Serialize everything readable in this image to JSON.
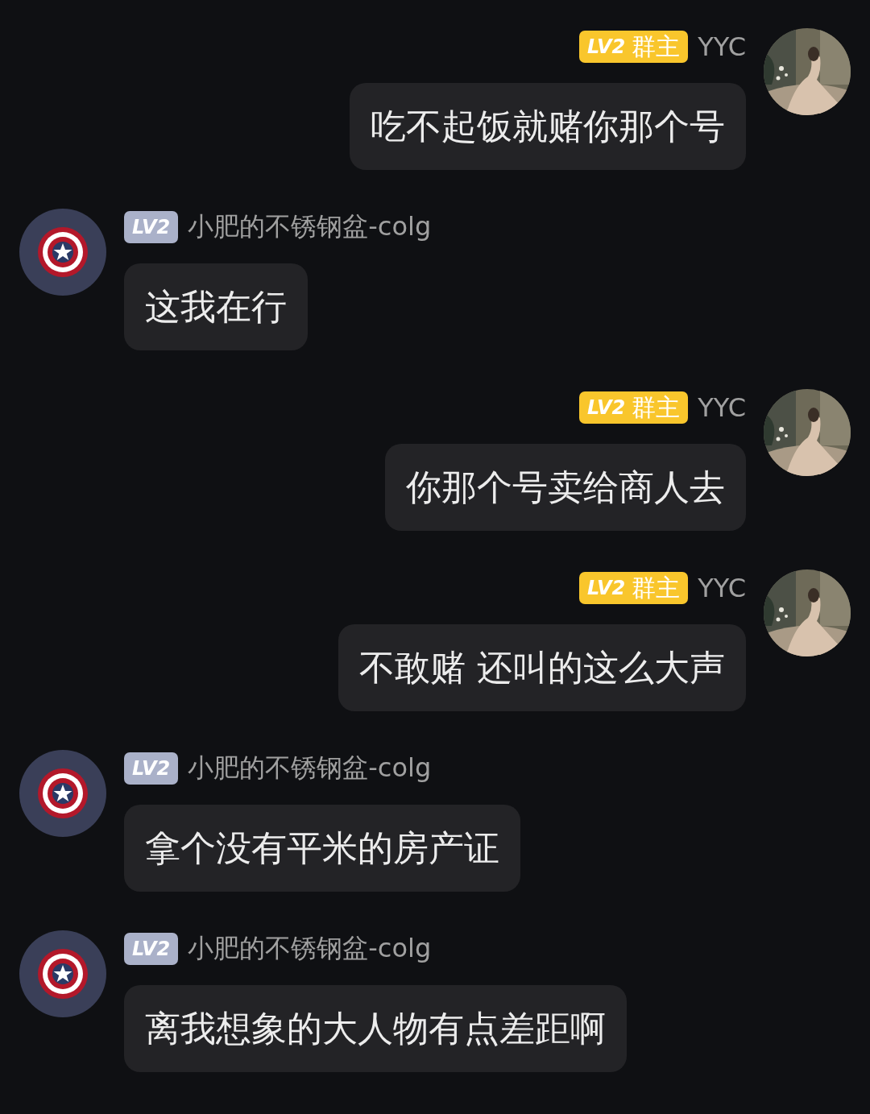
{
  "messages": [
    {
      "kind": "outgoing",
      "badge": {
        "level": "LV2",
        "role": "群主",
        "color": "#f9c62c"
      },
      "name": "YYC",
      "text": "吃不起饭就赌你那个号"
    },
    {
      "kind": "incoming",
      "badge": {
        "level": "LV2",
        "color": "#aab1c9"
      },
      "name": "小肥的不锈钢盆-colg",
      "text": "这我在行"
    },
    {
      "kind": "outgoing",
      "badge": {
        "level": "LV2",
        "role": "群主",
        "color": "#f9c62c"
      },
      "name": "YYC",
      "text": "你那个号卖给商人去"
    },
    {
      "kind": "outgoing",
      "badge": {
        "level": "LV2",
        "role": "群主",
        "color": "#f9c62c"
      },
      "name": "YYC",
      "text": "不敢赌 还叫的这么大声"
    },
    {
      "kind": "incoming",
      "badge": {
        "level": "LV2",
        "color": "#aab1c9"
      },
      "name": "小肥的不锈钢盆-colg",
      "text": "拿个没有平米的房产证"
    },
    {
      "kind": "incoming",
      "badge": {
        "level": "LV2",
        "color": "#aab1c9"
      },
      "name": "小肥的不锈钢盆-colg",
      "text": "离我想象的大人物有点差距啊"
    }
  ]
}
